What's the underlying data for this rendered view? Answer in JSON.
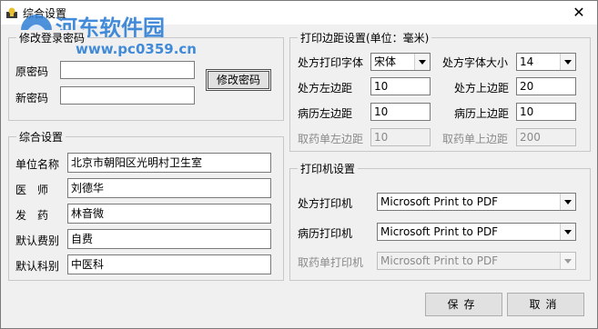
{
  "window": {
    "title": "综合设置",
    "watermark_name": "河东软件园",
    "watermark_url": "www.pc0359.cn"
  },
  "password_group": {
    "legend": "修改登录密码",
    "old_label": "原密码",
    "old_value": "",
    "new_label": "新密码",
    "new_value": "",
    "change_button": "修改密码"
  },
  "general_group": {
    "legend": "综合设置",
    "fields": [
      {
        "label": "单位名称",
        "value": "北京市朝阳区光明村卫生室"
      },
      {
        "label": "医　师",
        "value": "刘德华"
      },
      {
        "label": "发　药",
        "value": "林音微"
      },
      {
        "label": "默认费别",
        "value": "自费"
      },
      {
        "label": "默认科别",
        "value": "中医科"
      }
    ]
  },
  "margin_group": {
    "legend": "打印边距设置(单位：毫米)",
    "rx_font_label": "处方打印字体",
    "rx_font_value": "宋体",
    "rx_fontsize_label": "处方字体大小",
    "rx_fontsize_value": "14",
    "rx_left_label": "处方左边距",
    "rx_left_value": "10",
    "rx_top_label": "处方上边距",
    "rx_top_value": "20",
    "mr_left_label": "病历左边距",
    "mr_left_value": "10",
    "mr_top_label": "病历上边距",
    "mr_top_value": "10",
    "pick_left_label": "取药单左边距",
    "pick_left_value": "10",
    "pick_top_label": "取药单上边距",
    "pick_top_value": "200"
  },
  "printer_group": {
    "legend": "打印机设置",
    "rx_printer_label": "处方打印机",
    "rx_printer_value": "Microsoft Print to PDF",
    "mr_printer_label": "病历打印机",
    "mr_printer_value": "Microsoft Print to PDF",
    "pick_printer_label": "取药单打印机",
    "pick_printer_value": "Microsoft Print to PDF"
  },
  "footer": {
    "save_label": "保存",
    "cancel_label": "取消"
  }
}
